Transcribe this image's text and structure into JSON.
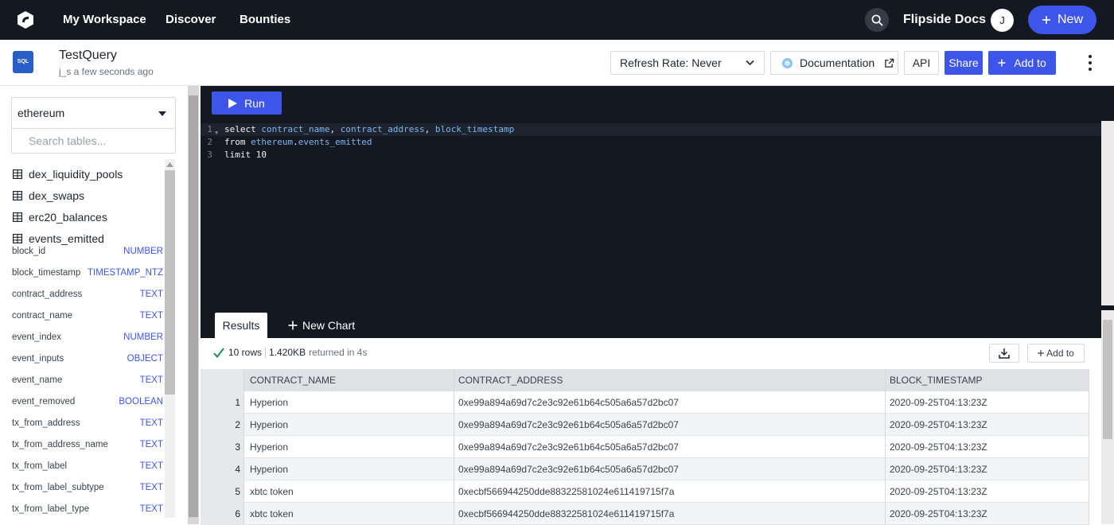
{
  "topnav": {
    "links": [
      "My Workspace",
      "Discover",
      "Bounties"
    ],
    "docs": "Flipside Docs",
    "avatar_initial": "J",
    "new_label": "New"
  },
  "query": {
    "badge": "SQL",
    "title": "TestQuery",
    "subtitle": "j_s a few seconds ago",
    "refresh_label": "Refresh Rate: Never",
    "documentation_label": "Documentation",
    "api_label": "API",
    "share_label": "Share",
    "add_to_label": "Add to"
  },
  "sidebar": {
    "database": "ethereum",
    "search_placeholder": "Search tables...",
    "tables": [
      "dex_liquidity_pools",
      "dex_swaps",
      "erc20_balances",
      "events_emitted"
    ],
    "columns": [
      {
        "name": "block_id",
        "type": "NUMBER"
      },
      {
        "name": "block_timestamp",
        "type": "TIMESTAMP_NTZ"
      },
      {
        "name": "contract_address",
        "type": "TEXT"
      },
      {
        "name": "contract_name",
        "type": "TEXT"
      },
      {
        "name": "event_index",
        "type": "NUMBER"
      },
      {
        "name": "event_inputs",
        "type": "OBJECT"
      },
      {
        "name": "event_name",
        "type": "TEXT"
      },
      {
        "name": "event_removed",
        "type": "BOOLEAN"
      },
      {
        "name": "tx_from_address",
        "type": "TEXT"
      },
      {
        "name": "tx_from_address_name",
        "type": "TEXT"
      },
      {
        "name": "tx_from_label",
        "type": "TEXT"
      },
      {
        "name": "tx_from_label_subtype",
        "type": "TEXT"
      },
      {
        "name": "tx_from_label_type",
        "type": "TEXT"
      }
    ]
  },
  "editor": {
    "run_label": "Run",
    "line_numbers": [
      "1",
      "2",
      "3"
    ],
    "lines": [
      [
        {
          "t": "select ",
          "c": "kw"
        },
        {
          "t": "contract_name",
          "c": "id"
        },
        {
          "t": ", ",
          "c": "kw"
        },
        {
          "t": "contract_address",
          "c": "id"
        },
        {
          "t": ", ",
          "c": "kw"
        },
        {
          "t": "block_timestamp",
          "c": "id"
        }
      ],
      [
        {
          "t": "from ",
          "c": "kw"
        },
        {
          "t": "ethereum",
          "c": "id"
        },
        {
          "t": ".",
          "c": "kw"
        },
        {
          "t": "events_emitted",
          "c": "id"
        }
      ],
      [
        {
          "t": "limit ",
          "c": "kw"
        },
        {
          "t": "10",
          "c": "kw"
        }
      ]
    ]
  },
  "results": {
    "tab_results": "Results",
    "tab_new_chart": "New Chart",
    "rows": "10 rows",
    "size": "1.420KB",
    "returned": "returned in 4s",
    "add_to_label": "Add to",
    "headers": [
      "CONTRACT_NAME",
      "CONTRACT_ADDRESS",
      "BLOCK_TIMESTAMP"
    ],
    "data": [
      [
        "1",
        "Hyperion",
        "0xe99a894a69d7c2e3c92e61b64c505a6a57d2bc07",
        "2020-09-25T04:13:23Z"
      ],
      [
        "2",
        "Hyperion",
        "0xe99a894a69d7c2e3c92e61b64c505a6a57d2bc07",
        "2020-09-25T04:13:23Z"
      ],
      [
        "3",
        "Hyperion",
        "0xe99a894a69d7c2e3c92e61b64c505a6a57d2bc07",
        "2020-09-25T04:13:23Z"
      ],
      [
        "4",
        "Hyperion",
        "0xe99a894a69d7c2e3c92e61b64c505a6a57d2bc07",
        "2020-09-25T04:13:23Z"
      ],
      [
        "5",
        "xbtc token",
        "0xecbf566944250dde88322581024e611419715f7a",
        "2020-09-25T04:13:23Z"
      ],
      [
        "6",
        "xbtc token",
        "0xecbf566944250dde88322581024e611419715f7a",
        "2020-09-25T04:13:23Z"
      ]
    ]
  },
  "colors": {
    "nav_bg": "#141821",
    "accent": "#3d55e8",
    "type_label": "#3d55e8",
    "editor_identifier": "#7cb8f0"
  }
}
